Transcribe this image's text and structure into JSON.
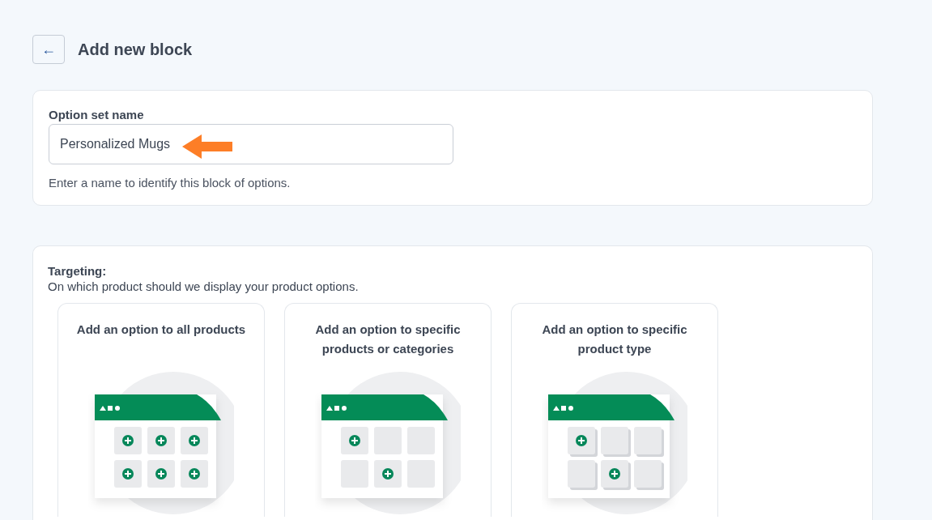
{
  "header": {
    "back_button": "←",
    "title": "Add new block"
  },
  "name_card": {
    "label": "Option set name",
    "value": "Personalized Mugs",
    "help": "Enter a name to identify this block of options.",
    "annotation_arrow": true
  },
  "targeting": {
    "title": "Targeting:",
    "subtitle": "On which product should we display your product options.",
    "options": [
      {
        "title": "Add an option to all products",
        "kind": "all"
      },
      {
        "title": "Add an option to specific products or categories",
        "kind": "specific"
      },
      {
        "title": "Add an option to specific product type",
        "kind": "type"
      }
    ]
  }
}
